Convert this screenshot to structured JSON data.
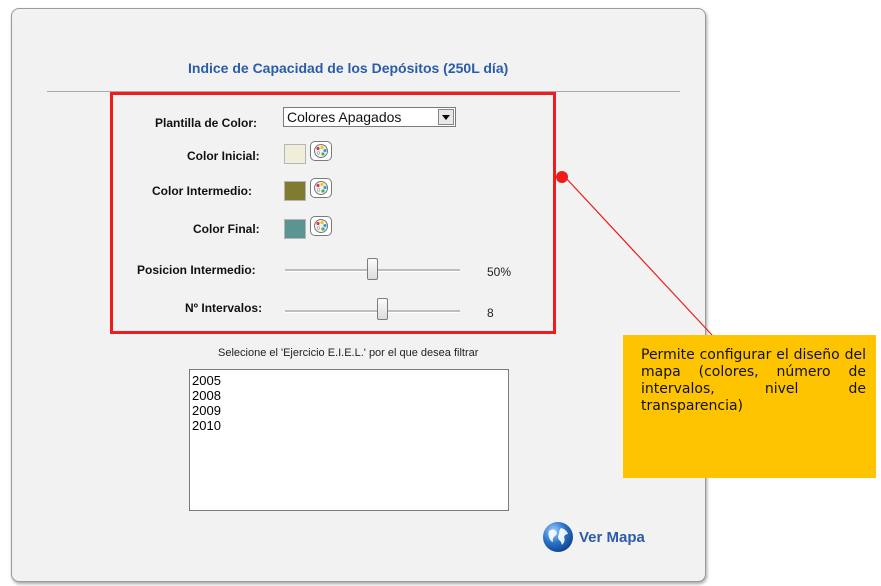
{
  "title": "Indice de Capacidad de los Depósitos (250L día)",
  "form": {
    "template_label": "Plantilla de Color:",
    "template_value": "Colores Apagados",
    "color_initial_label": "Color Inicial:",
    "color_initial": "#eeeed9",
    "color_intermediate_label": "Color Intermedio:",
    "color_intermediate": "#7f7b31",
    "color_final_label": "Color Final:",
    "color_final": "#5c9494",
    "position_label": "Posicion Intermedio:",
    "position_value": "50%",
    "position_fraction": 0.5,
    "intervals_label": "Nº Intervalos:",
    "intervals_value": "8",
    "icons": [
      "palette-icon",
      "chevron-down-icon",
      "globe-icon"
    ]
  },
  "filter": {
    "label": "Selecione el 'Ejercicio E.I.E.L.' por el que desea filtrar",
    "years": [
      "2005",
      "2008",
      "2009",
      "2010"
    ]
  },
  "action": {
    "ver_mapa": "Ver Mapa"
  },
  "callout": {
    "text": "Permite configurar el diseño del mapa (colores, número de intervalos, nivel de transparencia)",
    "highlight_color": "#ee1c1c",
    "background": "#ffc400"
  }
}
